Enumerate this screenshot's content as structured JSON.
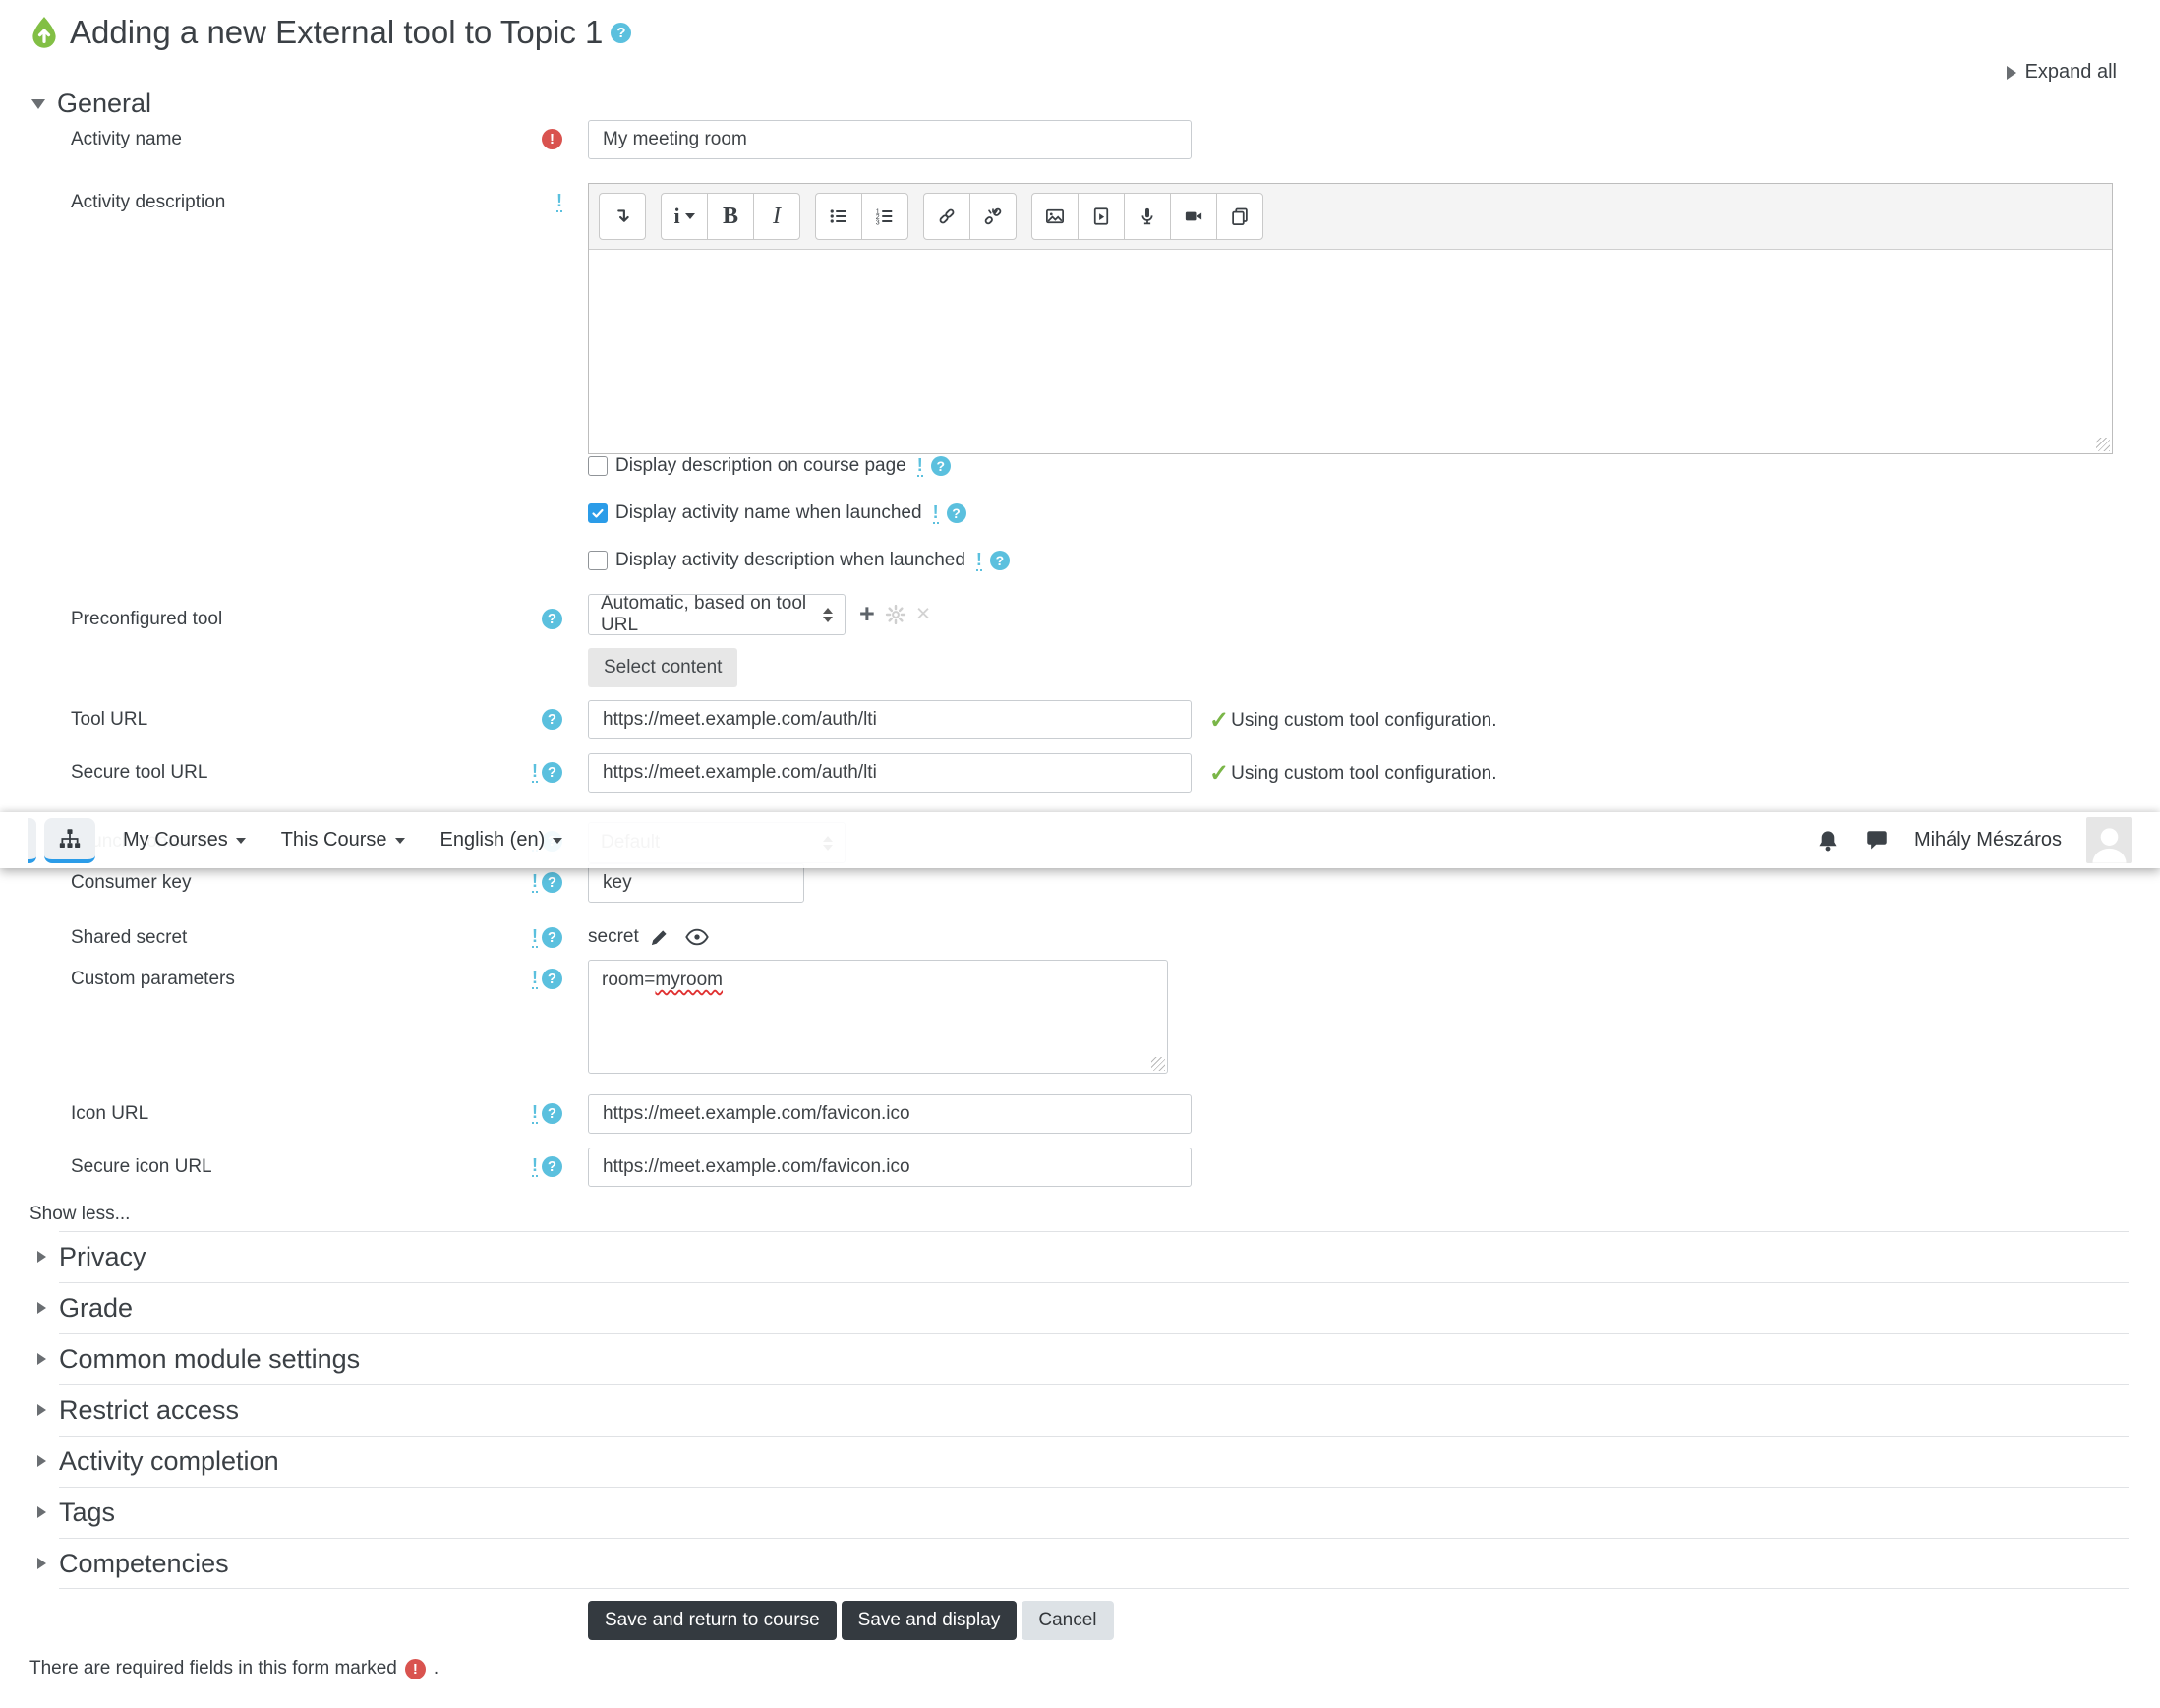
{
  "page": {
    "title": "Adding a new External tool to Topic 1",
    "expand_all": "Expand all",
    "show_less": "Show less...",
    "required_note": "There are required fields in this form marked",
    "required_note_suffix": "."
  },
  "navbar": {
    "items": [
      {
        "label": "My Courses"
      },
      {
        "label": "This Course"
      },
      {
        "label": "English (en)"
      }
    ],
    "user_name": "Mihály Mészáros"
  },
  "sections": {
    "general": "General",
    "collapsed": [
      "Privacy",
      "Grade",
      "Common module settings",
      "Restrict access",
      "Activity completion",
      "Tags",
      "Competencies"
    ]
  },
  "fields": {
    "activity_name": {
      "label": "Activity name",
      "value": "My meeting room"
    },
    "activity_description": {
      "label": "Activity description",
      "value": ""
    },
    "display_description": {
      "label": "Display description on course page",
      "checked": false
    },
    "display_name_launched": {
      "label": "Display activity name when launched",
      "checked": true
    },
    "display_desc_launched": {
      "label": "Display activity description when launched",
      "checked": false
    },
    "preconfigured_tool": {
      "label": "Preconfigured tool",
      "value": "Automatic, based on tool URL"
    },
    "select_content": {
      "label": "Select content"
    },
    "tool_url": {
      "label": "Tool URL",
      "value": "https://meet.example.com/auth/lti",
      "status": "Using custom tool configuration."
    },
    "secure_tool_url": {
      "label": "Secure tool URL",
      "value": "https://meet.example.com/auth/lti",
      "status": "Using custom tool configuration."
    },
    "launch_container": {
      "label": "Launch container",
      "value": "Default"
    },
    "consumer_key": {
      "label": "Consumer key",
      "value": "key"
    },
    "shared_secret": {
      "label": "Shared secret",
      "value": "secret"
    },
    "custom_parameters": {
      "label": "Custom parameters",
      "value_prefix": "room=",
      "value_word": "myroom"
    },
    "icon_url": {
      "label": "Icon URL",
      "value": "https://meet.example.com/favicon.ico"
    },
    "secure_icon_url": {
      "label": "Secure icon URL",
      "value": "https://meet.example.com/favicon.ico"
    }
  },
  "editor": {
    "bold": "B",
    "italic": "I",
    "styles": "i"
  },
  "buttons": {
    "save_return": "Save and return to course",
    "save_display": "Save and display",
    "cancel": "Cancel"
  },
  "colors": {
    "accent_blue": "#2b9ce8",
    "help_blue": "#5bc0de",
    "required_red": "#d9534f",
    "success_green": "#7ab648",
    "module_green": "#82bf45",
    "dark_button": "#343a40"
  }
}
